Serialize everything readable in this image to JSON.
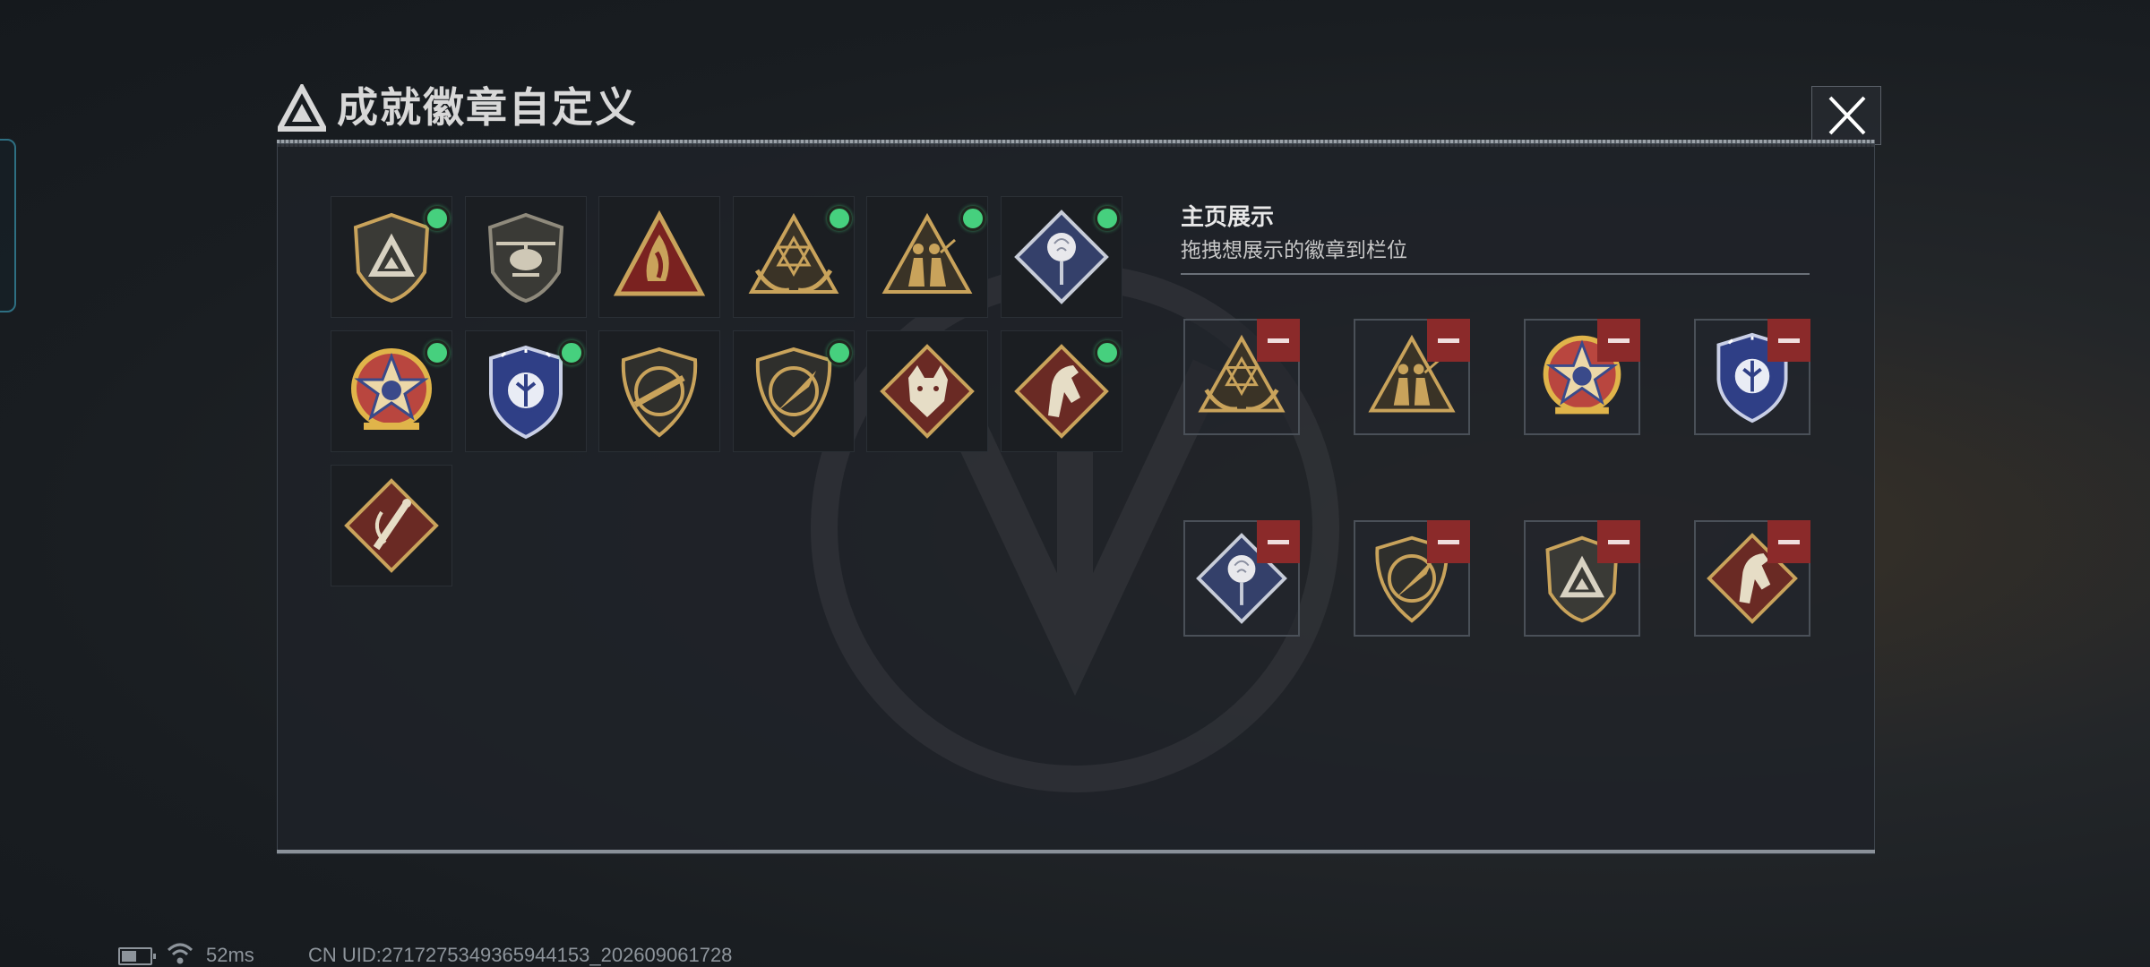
{
  "window": {
    "title": "成就徽章自定义"
  },
  "colors": {
    "owned_dot": "#46d07e",
    "remove_button": "#8b2a2a",
    "gold": "#c9a35b"
  },
  "badges": [
    {
      "icon": "shield-triangle-badge-icon",
      "owned": true
    },
    {
      "icon": "helicopter-badge-icon",
      "owned": false
    },
    {
      "icon": "flame-triangle-badge-icon",
      "owned": false
    },
    {
      "icon": "hexagram-triangle-badge-icon",
      "owned": true
    },
    {
      "icon": "soldiers-triangle-badge-icon",
      "owned": true
    },
    {
      "icon": "rose-diamond-badge-icon",
      "owned": true
    },
    {
      "icon": "star-medal-badge-icon",
      "owned": true
    },
    {
      "icon": "police-badge-icon",
      "owned": true
    },
    {
      "icon": "rifle-shield-badge-icon",
      "owned": false
    },
    {
      "icon": "knife-shield-badge-icon",
      "owned": true
    },
    {
      "icon": "wolf-diamond-badge-icon",
      "owned": false
    },
    {
      "icon": "horse-diamond-badge-icon",
      "owned": true
    },
    {
      "icon": "scroll-diamond-badge-icon",
      "owned": false
    }
  ],
  "showcase": {
    "title": "主页展示",
    "subtitle": "拖拽想展示的徽章到栏位",
    "slots": [
      {
        "icon": "hexagram-triangle-badge-icon"
      },
      {
        "icon": "soldiers-triangle-badge-icon"
      },
      {
        "icon": "star-medal-badge-icon"
      },
      {
        "icon": "police-badge-icon"
      },
      {
        "icon": "rose-diamond-badge-icon"
      },
      {
        "icon": "knife-shield-badge-icon"
      },
      {
        "icon": "shield-triangle-badge-icon"
      },
      {
        "icon": "horse-diamond-badge-icon"
      }
    ]
  },
  "status_bar": {
    "ping": "52ms",
    "uid": "CN UID:2717275349365944153_202609061728"
  }
}
